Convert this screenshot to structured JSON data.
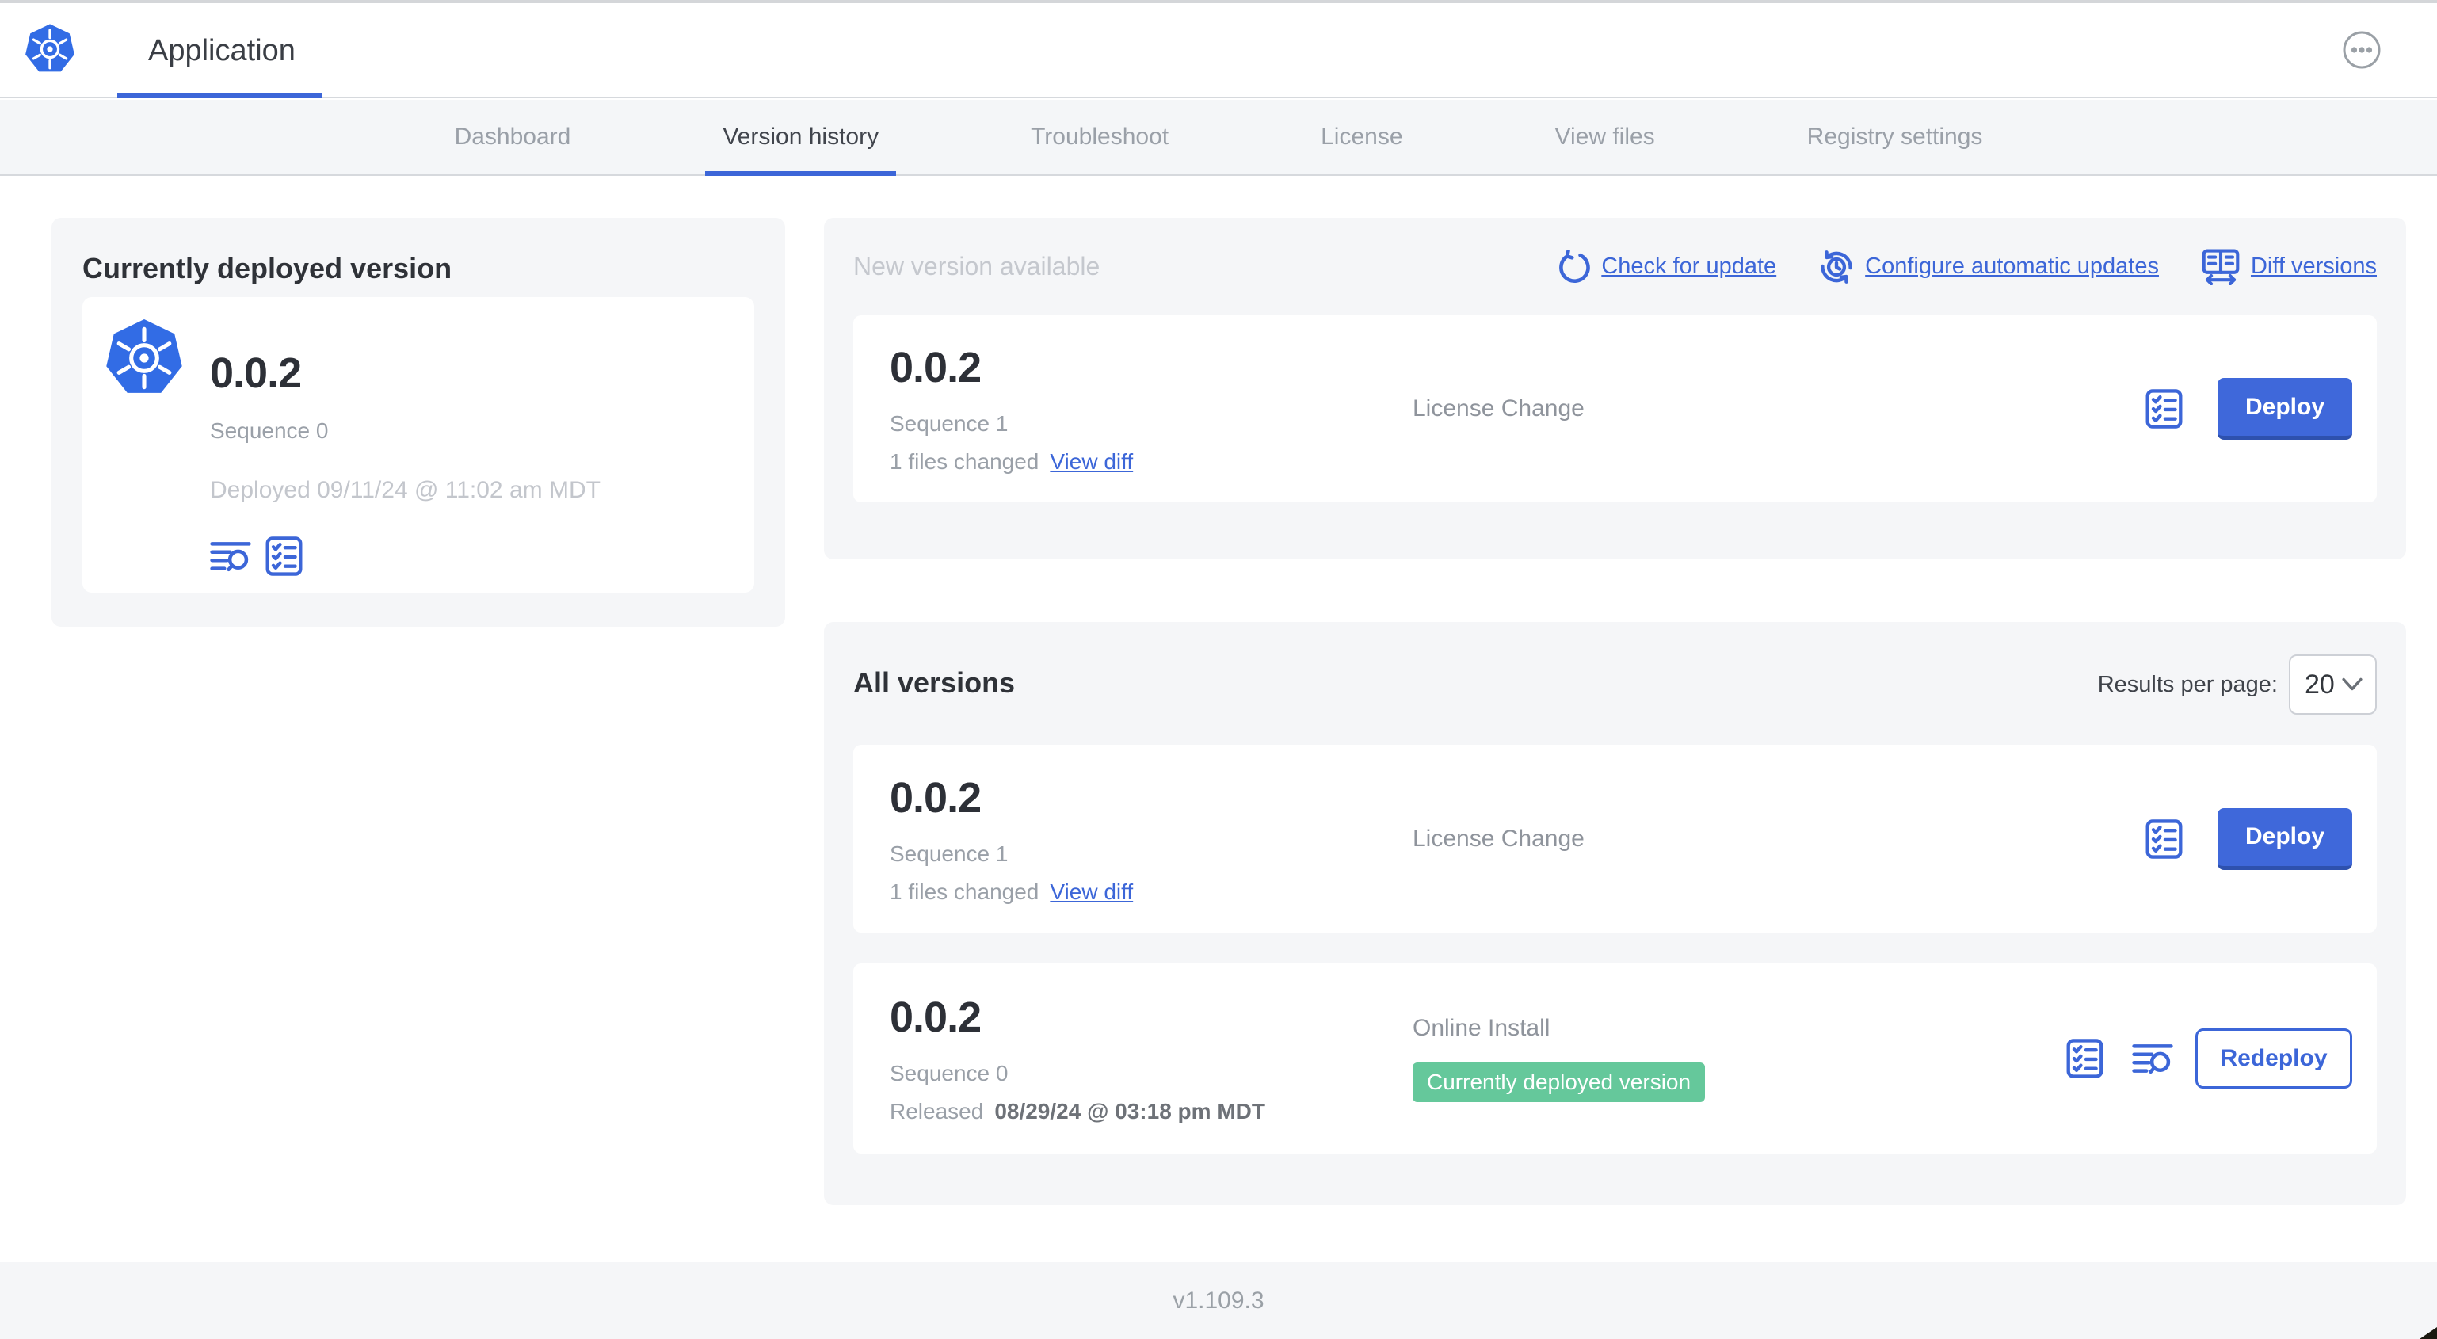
{
  "header": {
    "app_title": "Application",
    "logo_icon": "kubernetes-logo",
    "menu_icon": "ellipsis-menu"
  },
  "tabs": [
    {
      "label": "Dashboard",
      "active": false
    },
    {
      "label": "Version history",
      "active": true
    },
    {
      "label": "Troubleshoot",
      "active": false
    },
    {
      "label": "License",
      "active": false
    },
    {
      "label": "View files",
      "active": false
    },
    {
      "label": "Registry settings",
      "active": false
    }
  ],
  "currently_deployed": {
    "title": "Currently deployed version",
    "version": "0.0.2",
    "sequence": "Sequence 0",
    "deployed_at": "Deployed 09/11/24 @ 11:02 am MDT",
    "icons": [
      "deploy-logs-icon",
      "preflight-checklist-icon"
    ]
  },
  "new_version": {
    "title": "New version available",
    "actions": {
      "check_for_update": "Check for update",
      "configure_automatic_updates": "Configure automatic updates",
      "diff_versions": "Diff versions"
    },
    "card": {
      "version": "0.0.2",
      "sequence": "Sequence 1",
      "files_changed": "1 files changed",
      "view_diff": "View diff",
      "source": "License Change",
      "deploy_label": "Deploy"
    }
  },
  "all_versions": {
    "title": "All versions",
    "results_per_page_label": "Results per page:",
    "results_per_page_value": "20",
    "rows": [
      {
        "version": "0.0.2",
        "sequence": "Sequence 1",
        "files_changed": "1 files changed",
        "view_diff": "View diff",
        "source": "License Change",
        "action_label": "Deploy"
      },
      {
        "version": "0.0.2",
        "sequence": "Sequence 0",
        "released_prefix": "Released ",
        "released_date": "08/29/24 @ 03:18 pm MDT",
        "source": "Online Install",
        "badge": "Currently deployed version",
        "action_label": "Redeploy"
      }
    ]
  },
  "footer": {
    "app_version": "v1.109.3"
  },
  "colors": {
    "primary_blue": "#3c66d8",
    "button_blue": "#3f68da",
    "badge_green": "#65c89b",
    "section_gray": "#f5f6f8",
    "kubernetes_blue": "#326ce5"
  }
}
